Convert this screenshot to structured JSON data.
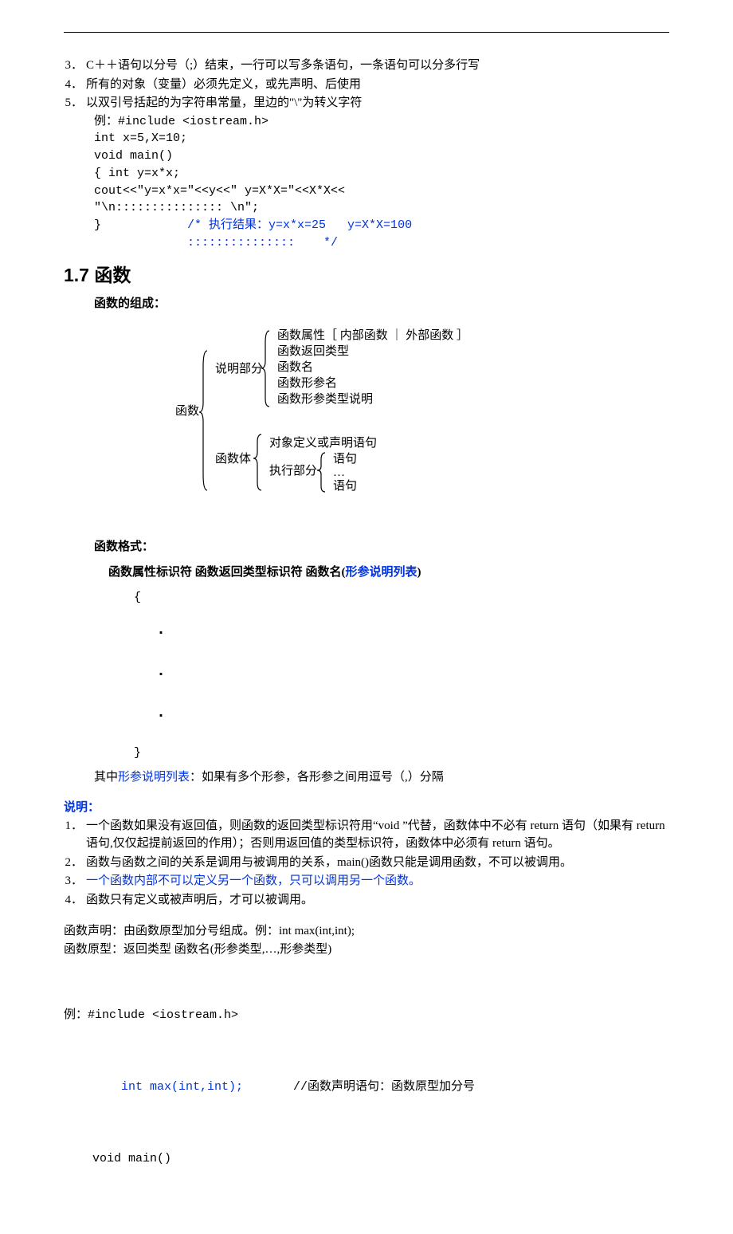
{
  "list1": {
    "it3": {
      "num": "3．",
      "txt": "C＋＋语句以分号（;）结束，一行可以写多条语句，一条语句可以分多行写"
    },
    "it4": {
      "num": "4．",
      "txt": "所有的对象（变量）必须先定义，或先声明、后使用"
    },
    "it5": {
      "num": "5．",
      "txt": "以双引号括起的为字符串常量，里边的\"\\\"为转义字符"
    }
  },
  "code1": {
    "l1": "例：#include <iostream.h>",
    "l2": "int x=5,X=10;",
    "l3": "",
    "l4": "void main()",
    "l5": "{ int y=x*x;",
    "l6": "  cout<<\"y=x*x=\"<<y<<\"   y=X*X=\"<<X*X<<",
    "l7": "  \"\\n::::::::::::::: \\n\";",
    "l8a": "}            ",
    "l8b": "/* 执行结果：y=x*x=25   y=X*X=100",
    "l9": "             :::::::::::::::    */"
  },
  "heading": "1.7  函数",
  "composition_label": "函数的组成：",
  "tree": {
    "root": "函数",
    "b1": "说明部分",
    "b1_items": [
      "函数属性［ 内部函数 ｜ 外部函数 ］",
      "函数返回类型",
      "函数名",
      "函数形参名",
      "函数形参类型说明"
    ],
    "b2": "函数体",
    "b2_items": [
      "对象定义或声明语句"
    ],
    "b2_exec": "执行部分",
    "b2_exec_items": [
      "语句",
      "…",
      "语句"
    ]
  },
  "format_label": "函数格式：",
  "format_line": {
    "pre": "函数属性标识符  函数返回类型标识符  函数名(",
    "blue": "形参说明列表",
    "post": ")"
  },
  "braces": {
    "open": "{",
    "close": "}",
    "dot": "·"
  },
  "where": {
    "pre": "其中",
    "blue": "形参说明列表",
    "post": "：如果有多个形参，各形参之间用逗号（,）分隔"
  },
  "notes_label": "说明：",
  "notes": {
    "n1": {
      "num": "1．",
      "txt": "一个函数如果没有返回值，则函数的返回类型标识符用“void ”代替，函数体中不必有 return 语句（如果有 return 语句,仅仅起提前返回的作用）；否则用返回值的类型标识符，函数体中必须有 return 语句。"
    },
    "n2": {
      "num": "2．",
      "txt": "函数与函数之间的关系是调用与被调用的关系，main()函数只能是调用函数，不可以被调用。"
    },
    "n3": {
      "num": "3．",
      "txt": "一个函数内部不可以定义另一个函数，只可以调用另一个函数。"
    },
    "n4": {
      "num": "4．",
      "txt": "函数只有定义或被声明后，才可以被调用。"
    }
  },
  "decl": {
    "l1": "函数声明：由函数原型加分号组成。例：int max(int,int);",
    "l2": "函数原型：返回类型  函数名(形参类型,…,形参类型)"
  },
  "ex2": {
    "l1": "例：#include <iostream.h>",
    "l2a": "    int max(int,int);",
    "l2b": "       //函数声明语句：函数原型加分号",
    "l3": "    void main()"
  }
}
